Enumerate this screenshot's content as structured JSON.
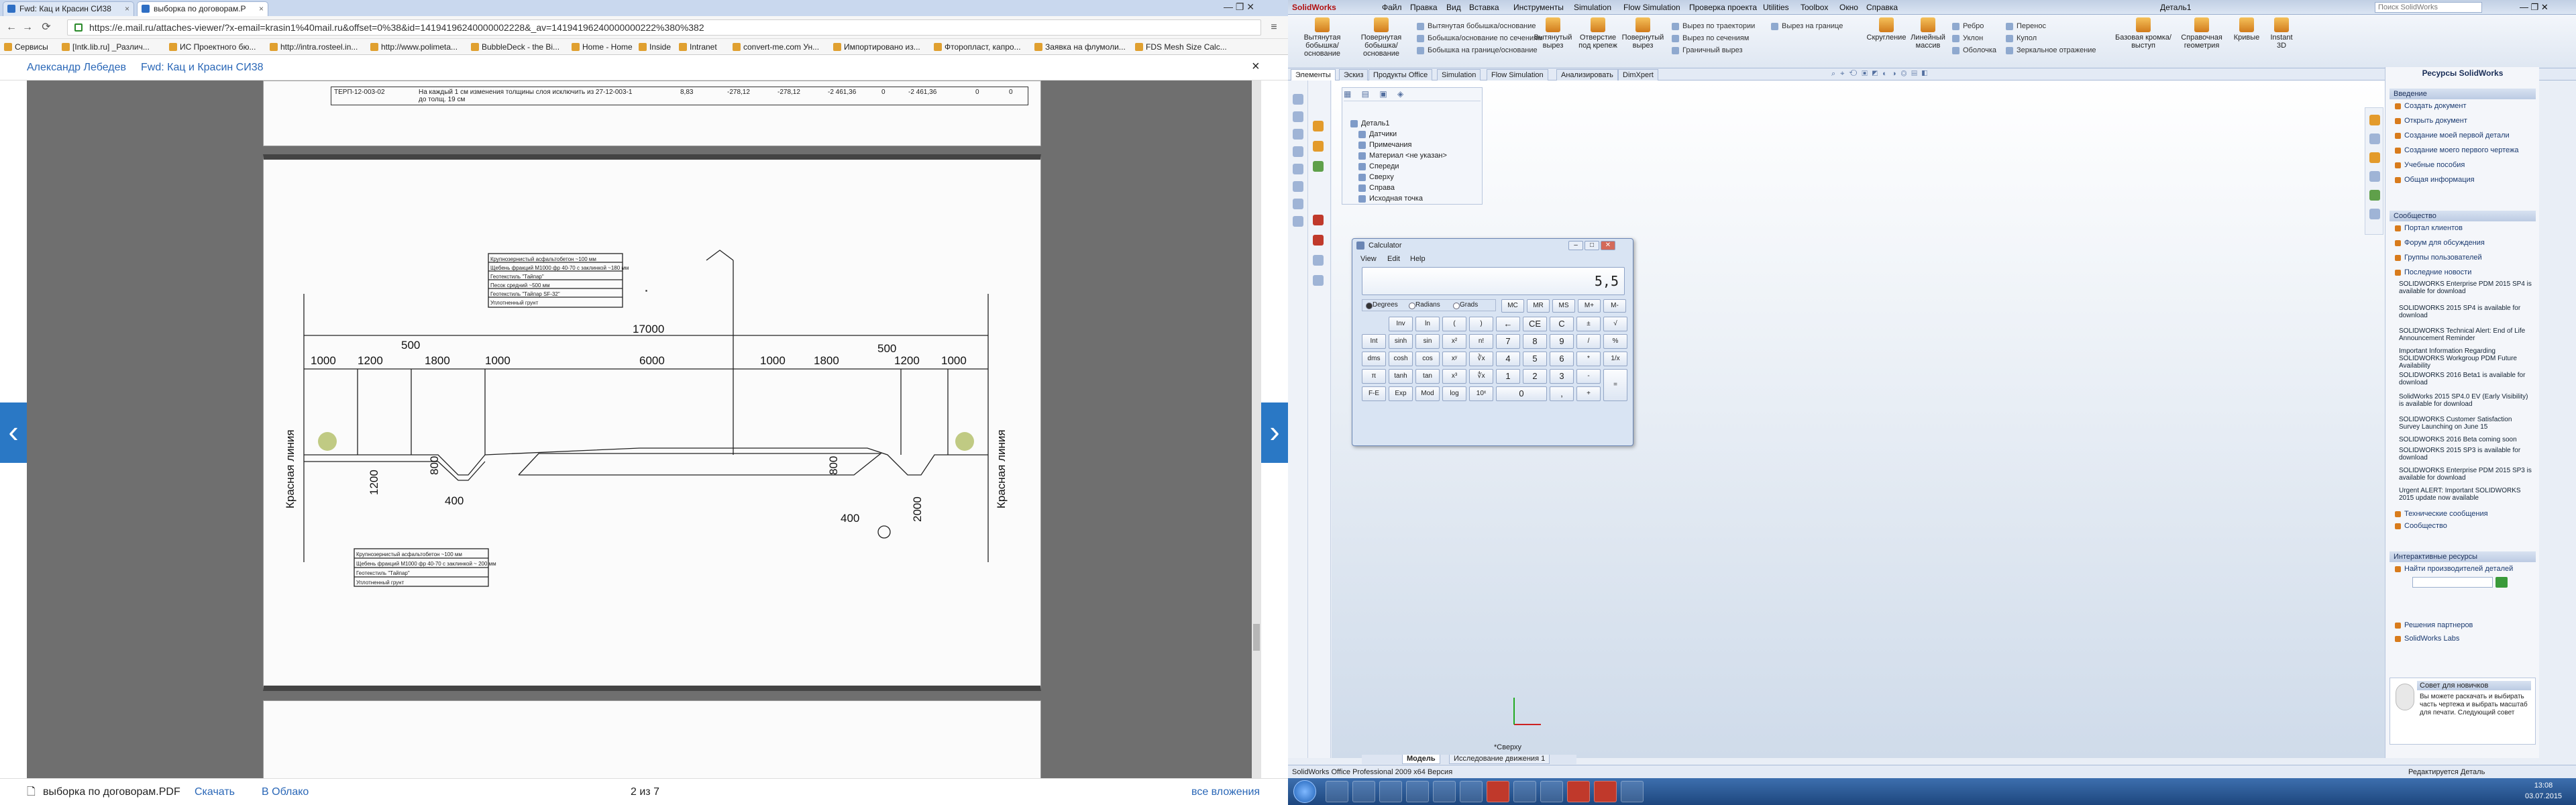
{
  "browser": {
    "tabs": [
      {
        "label": "Fwd: Кац и Красин СИ38"
      },
      {
        "label": "выборка по договорам.P"
      }
    ],
    "url": "https://e.mail.ru/attaches-viewer/?x-email=krasin1%40mail.ru&offset=0%38&id=14194196240000002228&_av=14194196240000000222%380%382",
    "bookmarks": [
      "Сервисы",
      "[Intk.lib.ru] _Различ...",
      "ИС Проектного бю...",
      "http://intra.rosteel.in...",
      "http://www.polimeta...",
      "BubbleDeck - the Bi...",
      "Home - Home",
      "Inside",
      "Intranet",
      "convert-me.com Ун...",
      "Импортировано из...",
      "Фторопласт, капро...",
      "Заявка на флумоли...",
      "FDS Mesh Size Calc..."
    ],
    "mail_sender": "Александр Лебедев",
    "mail_subject": "Fwd: Кац и Красин СИ38",
    "footer": {
      "filename": "выборка по договорам.PDF",
      "download": "Скачать",
      "cloud": "В Облако",
      "pages": "2 из 7",
      "all_attachments": "все вложения"
    },
    "pdf_page1_row": [
      "ТЕРП-12-003-02",
      "На каждый 1 см изменения толщины слоя исключить из 27-12-003-1 до толщ. 19 см",
      "8,83",
      "-278,12",
      "-278,12",
      "-2 461,36",
      "0",
      "-2 461,36",
      "0",
      "0"
    ],
    "drawing": {
      "legend_top": [
        "Крупнозернистый асфальтобетон ~100 мм",
        "Щебень фракций М1000 фр 40-70 с заклинкой ~180 мм",
        "Геотекстиль \"Тайпар\"",
        "Песок средний ~500 мм",
        "Геотекстиль \"Тайпар SF-32\"",
        "Уплотненный грунт"
      ],
      "legend_bottom": [
        "Крупнозернистый асфальтобетон ~100 мм",
        "Щебень фракций М1000 фр 40-70 с заклинкой ~ 200 мм",
        "Геотекстиль \"Тайпар\"",
        "Уплотненный грунт"
      ],
      "total": "17000",
      "dims_left": [
        "1000",
        "1200",
        "1800",
        "1000"
      ],
      "dim_500_left": "500",
      "carriageway": "6000",
      "dims_right": [
        "1000",
        "1800",
        "1200",
        "1000"
      ],
      "dim_500_right": "500",
      "red_line_left": "Красная линия",
      "red_line_right": "Красная линия",
      "small_dims": [
        "800",
        "400",
        "800",
        "400",
        "1200",
        "2000"
      ]
    }
  },
  "solidworks": {
    "app_name": "SolidWorks",
    "menu": [
      "Файл",
      "Правка",
      "Вид",
      "Вставка",
      "Инструменты",
      "Simulation",
      "Flow Simulation",
      "Проверка проекта",
      "Utilities",
      "Toolbox",
      "Окно",
      "Справка"
    ],
    "doc_title": "Деталь1",
    "search": "Поиск SolidWorks",
    "ribbon_big": [
      "Вытянутая бобышка/основание",
      "Повернутая бобышка/основание",
      "Вытянутый вырез",
      "Отверстие под крепеж",
      "Повернутый вырез",
      "Скругление",
      "Линейный массив",
      "Базовая кромка/выступ",
      "Справочная геометрия",
      "Кривые",
      "Instant 3D"
    ],
    "ribbon_small": [
      "Вытянутая бобышка/основание",
      "Бобышка/основание по сечениям",
      "Бобышка на границе/основание",
      "Вырез по траектории",
      "Вырез по сечениям",
      "Граничный вырез",
      "Вырез на границе",
      "Ребро",
      "Уклон",
      "Оболочка",
      "Перенос",
      "Купол",
      "Зеркальное отражение"
    ],
    "tabs": [
      "Элементы",
      "Эскиз",
      "Продукты Office",
      "Simulation",
      "Flow Simulation",
      "Анализировать",
      "DimXpert"
    ],
    "tree": [
      "Деталь1",
      "Датчики",
      "Примечания",
      "Материал <не указан>",
      "Спереди",
      "Сверху",
      "Справа",
      "Исходная точка"
    ],
    "bottom_tabs": [
      "Модель",
      "Исследование движения 1"
    ],
    "status": "SolidWorks Office Professional 2009 x64 Версия",
    "status_right": "Редактируется Деталь",
    "view_label": "*Сверху",
    "resources": {
      "title": "Ресурсы SolidWorks",
      "intro_title": "Введение",
      "intro": [
        "Создать документ",
        "Открыть документ",
        "Создание моей первой детали",
        "Создание моего первого чертежа",
        "Учебные пособия",
        "Общая информация"
      ],
      "community_title": "Сообщество",
      "community": [
        "Портал клиентов",
        "Форум для обсуждения",
        "Группы пользователей",
        "Последние новости"
      ],
      "news": [
        "SOLIDWORKS Enterprise PDM 2015 SP4 is available for download",
        "SOLIDWORKS 2015 SP4 is available for download",
        "SOLIDWORKS Technical Alert: End of Life Announcement Reminder",
        "Important Information Regarding SOLIDWORKS Workgroup PDM Future Availability",
        "SOLIDWORKS 2016 Beta1 is available for download",
        "SolidWorks 2015 SP4.0 EV (Early Visibility) is available for download",
        "SOLIDWORKS Customer Satisfaction Survey Launching on June 15",
        "SOLIDWORKS 2016 Beta coming soon",
        "SOLIDWORKS 2015 SP3 is available for download",
        "SOLIDWORKS Enterprise PDM 2015 SP3 is available for download",
        "Urgent ALERT: Important SOLIDWORKS 2015 update now available"
      ],
      "tech_msgs": "Технические сообщения",
      "community_msgs": "Сообщество",
      "online_title": "Интерактивные ресурсы",
      "find_parts": "Найти производителей деталей",
      "partners": "Решения партнеров",
      "labs": "SolidWorks Labs",
      "tip_title": "Совет для новичков",
      "tip": "Вы можете раскачать и выбирать часть чертежа и выбрать масштаб для печати. Следующий совет"
    }
  },
  "calculator": {
    "title": "Calculator",
    "menu": [
      "View",
      "Edit",
      "Help"
    ],
    "display": "5,5",
    "modes": [
      "Degrees",
      "Radians",
      "Grads"
    ],
    "selected_mode": "Degrees",
    "mem": [
      "MC",
      "MR",
      "MS",
      "M+",
      "M-"
    ],
    "keys": [
      [
        "",
        "Inv",
        "ln",
        "(",
        ")",
        "←",
        "CE",
        "C",
        "±",
        "√"
      ],
      [
        "Int",
        "sinh",
        "sin",
        "x²",
        "n!",
        "7",
        "8",
        "9",
        "/",
        "%"
      ],
      [
        "dms",
        "cosh",
        "cos",
        "xʸ",
        "∛x",
        "4",
        "5",
        "6",
        "*",
        "1/x"
      ],
      [
        "π",
        "tanh",
        "tan",
        "x³",
        "∜x",
        "1",
        "2",
        "3",
        "-",
        "="
      ],
      [
        "F-E",
        "Exp",
        "Mod",
        "log",
        "10ˣ",
        "0",
        "",
        ",",
        "+",
        ""
      ]
    ]
  },
  "clock": {
    "time": "13:08",
    "date": "03.07.2015"
  }
}
